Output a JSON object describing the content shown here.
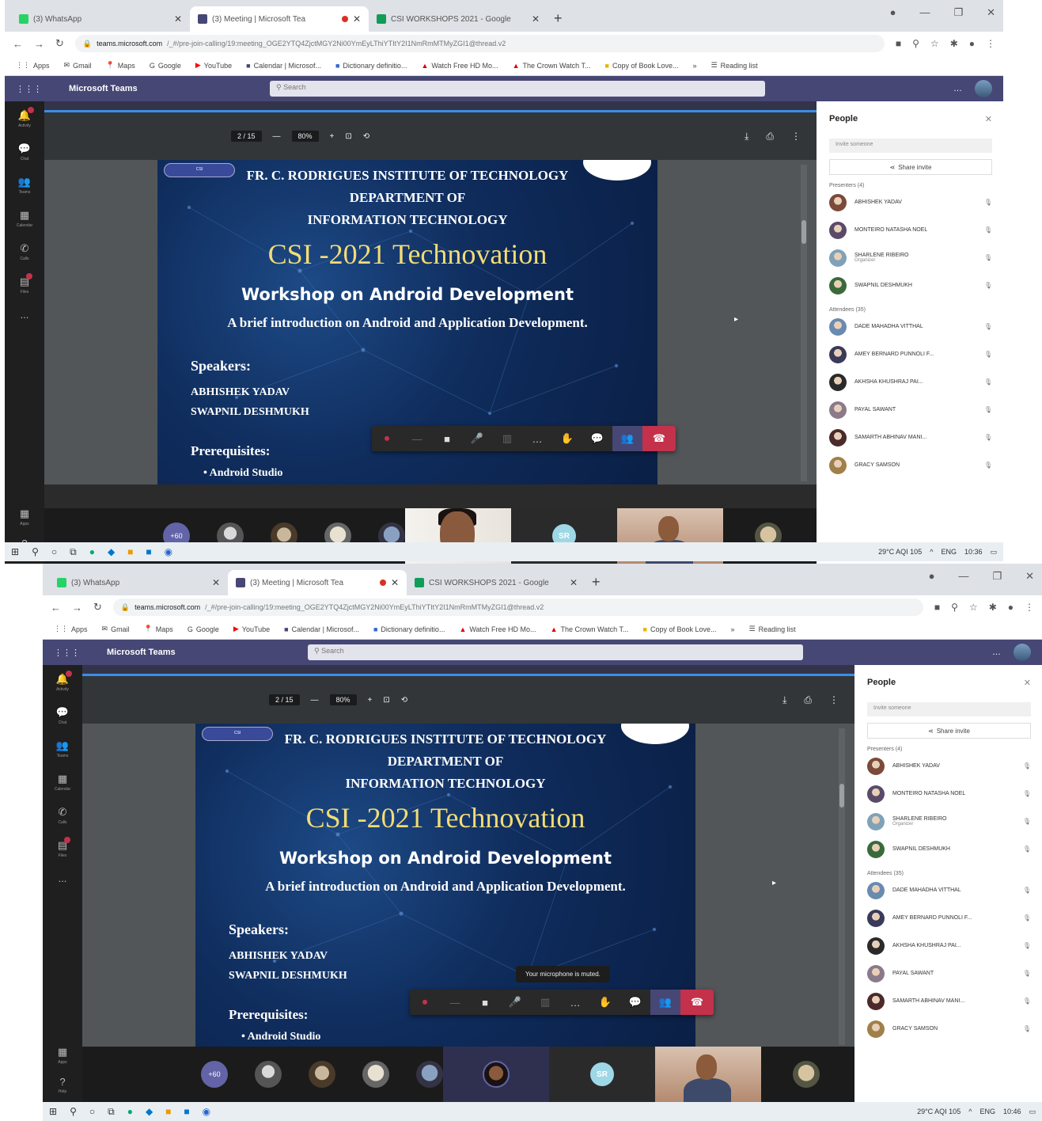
{
  "browser": {
    "tabs": [
      {
        "title": "(3) WhatsApp",
        "color": "#25d366"
      },
      {
        "title": "(3) Meeting | Microsoft Tea",
        "color": "#464775",
        "active": true,
        "recording": true
      },
      {
        "title": "CSI WORKSHOPS 2021 - Google",
        "color": "#0f9d58"
      }
    ],
    "new_tab": "+",
    "url_host": "teams.microsoft.com",
    "url_path": "/_#/pre-join-calling/19:meeting_OGE2YTQ4ZjctMGY2Ni00YmEyLThiYTItY2I1NmRmMTMyZGI1@thread.v2",
    "bookmarks": [
      "Apps",
      "Gmail",
      "Maps",
      "Google",
      "YouTube",
      "Calendar | Microsof...",
      "Dictionary definitio...",
      "Watch Free HD Mo...",
      "The Crown Watch T...",
      "Copy of Book Love...",
      "»",
      "Reading list"
    ]
  },
  "teams": {
    "app_title": "Microsoft Teams",
    "search_placeholder": "Search",
    "rail": [
      "Activity",
      "Chat",
      "Teams",
      "Calendar",
      "Calls",
      "Files",
      "..."
    ],
    "rail_bottom": [
      "Apps",
      "Help"
    ]
  },
  "pdf": {
    "page": "2 / 15",
    "zoom": "80%",
    "zoom_minus": "—",
    "zoom_plus": "+"
  },
  "slide": {
    "institute": "FR. C. RODRIGUES INSTITUTE OF TECHNOLOGY",
    "department": "DEPARTMENT OF",
    "department2": "INFORMATION TECHNOLOGY",
    "event": "CSI -2021 Technovation",
    "workshop": "Workshop on Android Development",
    "brief": "A brief introduction on Android and Application Development.",
    "speakers_heading": "Speakers:",
    "speaker1": "ABHISHEK YADAV",
    "speaker2": "SWAPNIL DESHMUKH",
    "prereq_heading": "Prerequisites:",
    "prereq1": "Android Studio"
  },
  "toast": "Your microphone is muted.",
  "gallery": {
    "more": "+60",
    "sr_initials": "SR"
  },
  "people_panel": {
    "title": "People",
    "invite_placeholder": "Invite someone",
    "share_invite": "Share invite",
    "presenters_heading": "Presenters (4)",
    "attendees_heading": "Attendees (35)",
    "presenters": [
      {
        "name": "ABHISHEK YADAV",
        "color": "#7b4a3a"
      },
      {
        "name": "MONTEIRO NATASHA NOEL",
        "color": "#5a4a6a"
      },
      {
        "name": "SHARLENE RIBEIRO",
        "role": "Organizer",
        "color": "#7fa2b8"
      },
      {
        "name": "SWAPNIL DESHMUKH",
        "color": "#3a6a3a"
      }
    ],
    "attendees": [
      {
        "name": "DADE MAHADHA VITTHAL",
        "color": "#6a8ab0"
      },
      {
        "name": "AMEY BERNARD PUNNOLI F...",
        "color": "#3a3a5a"
      },
      {
        "name": "AKHSHA KHUSHRAJ PAI...",
        "color": "#2a2a2a"
      },
      {
        "name": "PAYAL SAWANT",
        "color": "#8a7a8a"
      },
      {
        "name": "SAMARTH ABHINAV MANI...",
        "color": "#4a2a2a"
      },
      {
        "name": "GRACY SAMSON",
        "color": "#a0804a"
      }
    ]
  },
  "taskbar": {
    "weather": "29°C  AQI 105",
    "lang": "ENG",
    "time1": "10:36",
    "time2": "10:46"
  }
}
